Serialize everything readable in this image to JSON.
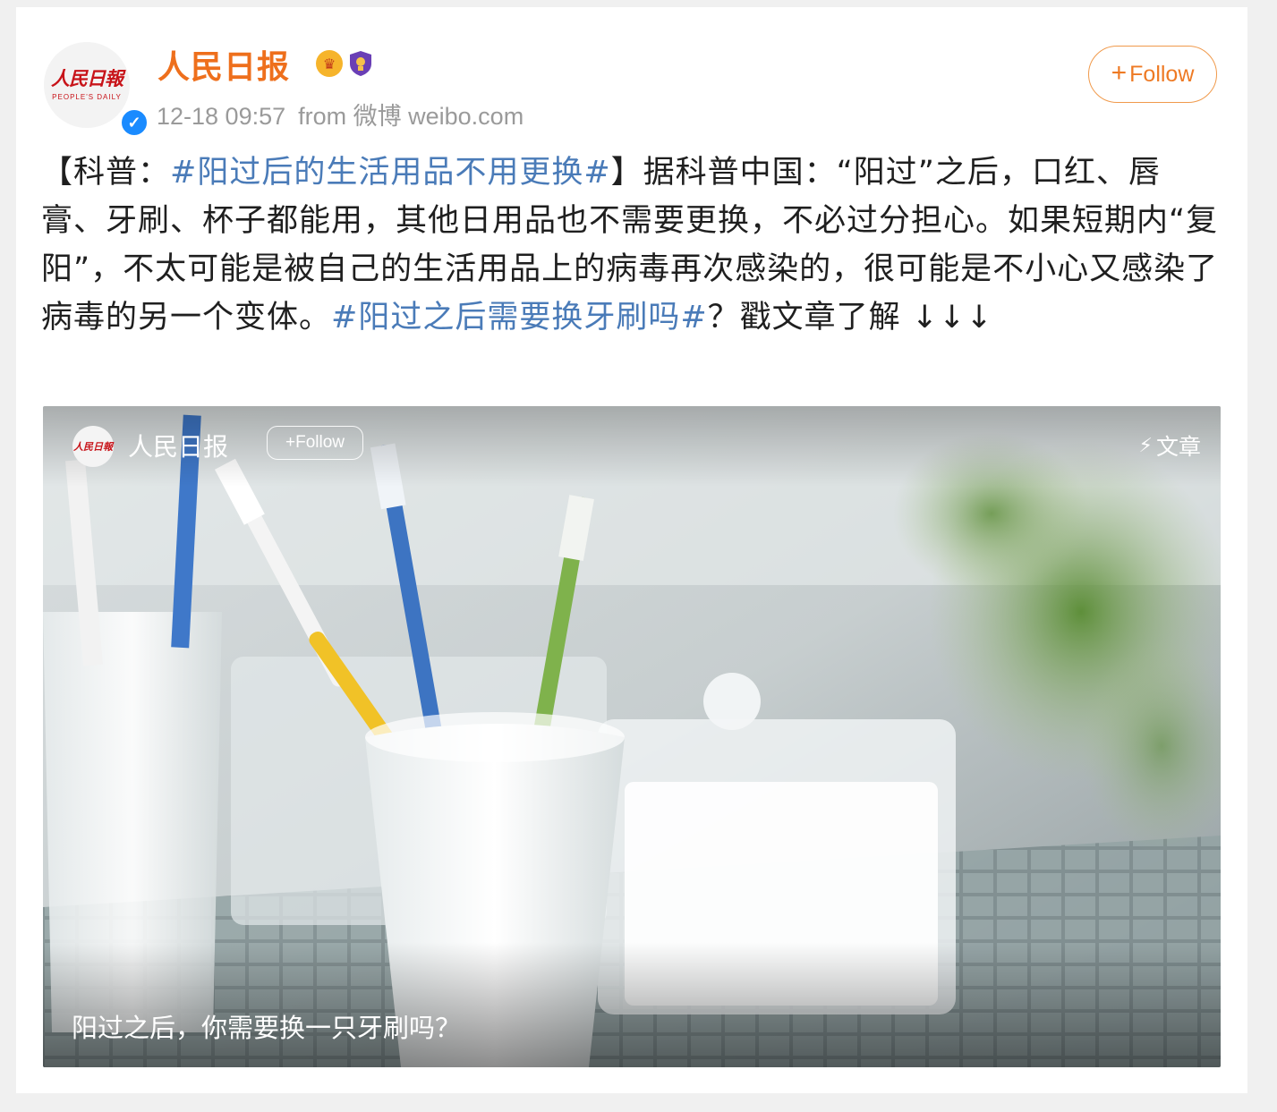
{
  "post": {
    "username": "人民日报",
    "avatar_logo_text": "人民日報",
    "avatar_logo_subtext": "PEOPLE'S DAILY",
    "timestamp": "12-18 09:57",
    "source": "from 微博 weibo.com",
    "follow_label": "Follow",
    "follow_plus": "+",
    "badges": [
      "crown-icon",
      "shield-icon"
    ],
    "content": {
      "prefix": "【科普：",
      "tag1": "#阳过后的生活用品不用更换#",
      "body": "】据科普中国：“阳过”之后，口红、唇膏、牙刷、杯子都能用，其他日用品也不需要更换，不必过分担心。如果短期内“复阳”，不太可能是被自己的生活用品上的病毒再次感染的，很可能是不小心又感染了病毒的另一个变体。",
      "tag2": "#阳过之后需要换牙刷吗#",
      "suffix": "？戳文章了解 ↓↓↓"
    }
  },
  "article_card": {
    "account_name": "人民日报",
    "avatar_logo_text": "人民日報",
    "follow_label": "+Follow",
    "article_label": "文章",
    "caption": "阳过之后，你需要换一只牙刷吗？"
  },
  "colors": {
    "username": "#ee6f1c",
    "hashtag": "#4a7bb8",
    "follow_border": "#f09a4c",
    "verified": "#1a8bff"
  }
}
